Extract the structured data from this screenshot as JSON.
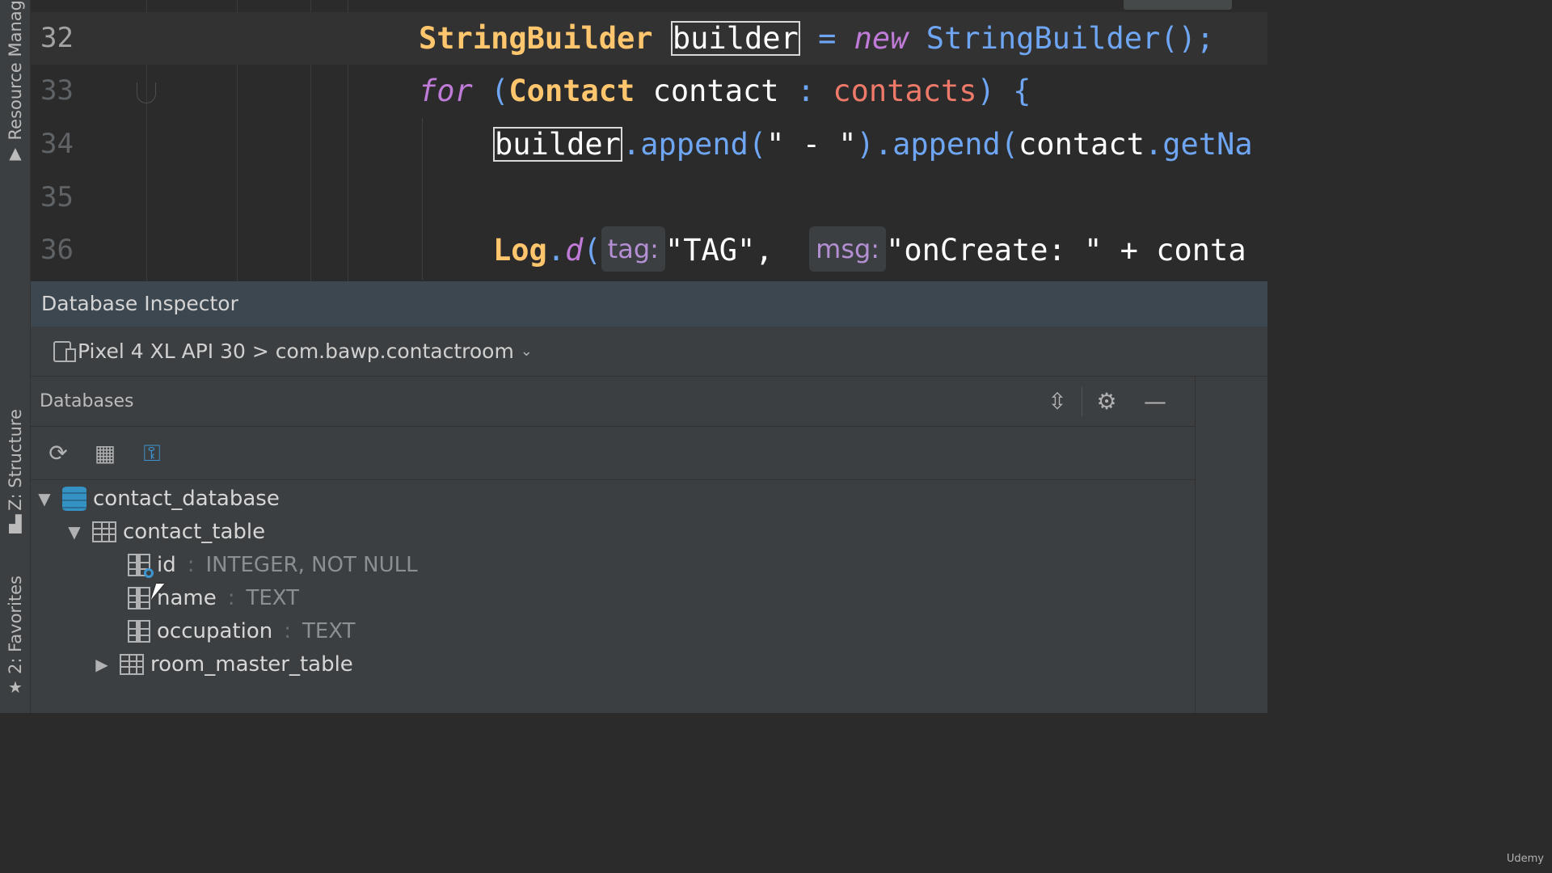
{
  "sidebar": {
    "resource_manager": "Resource Manag",
    "structure": "Z: Structure",
    "favorites": "2: Favorites"
  },
  "editor": {
    "lines": [
      {
        "number": "32"
      },
      {
        "number": "33"
      },
      {
        "number": "34"
      },
      {
        "number": "35"
      },
      {
        "number": "36"
      }
    ],
    "line32": {
      "type": "StringBuilder",
      "var": "builder",
      "eq": " = ",
      "new": "new",
      "ctor": " StringBuilder();"
    },
    "line33": {
      "for": "for",
      "open": " (",
      "type": "Contact",
      "var": " contact ",
      "colon": ": ",
      "coll": "contacts",
      "close": ") {"
    },
    "line34": {
      "var": "builder",
      "m1": ".append(",
      "s1": "\" - \"",
      "m2": ").append(",
      "arg": "contact",
      "m3": ".getNa"
    },
    "line36": {
      "cls": "Log",
      "dot": ".",
      "method": "d",
      "paren": "(",
      "hint_tag": "tag:",
      "s_tag": "\"TAG\", ",
      "hint_msg": "msg:",
      "s_msg": "\"onCreate: \" + conta"
    }
  },
  "inspector": {
    "title": "Database Inspector",
    "device": "Pixel 4 XL API 30 > com.bawp.contactroom",
    "databases_label": "Databases",
    "tree": {
      "database": "contact_database",
      "table": "contact_table",
      "columns": [
        {
          "name": "id",
          "type": "INTEGER, NOT NULL",
          "primary_key": true
        },
        {
          "name": "name",
          "type": "TEXT"
        },
        {
          "name": "occupation",
          "type": "TEXT"
        }
      ],
      "sep": ":",
      "other_table": "room_master_table"
    }
  },
  "watermark": "Udemy",
  "icons": {
    "refresh": "refresh-icon",
    "query": "query-table-icon",
    "live": "live-updates-icon",
    "collapse": "collapse-all-icon",
    "settings": "gear-icon",
    "minimize": "minimize-icon"
  }
}
